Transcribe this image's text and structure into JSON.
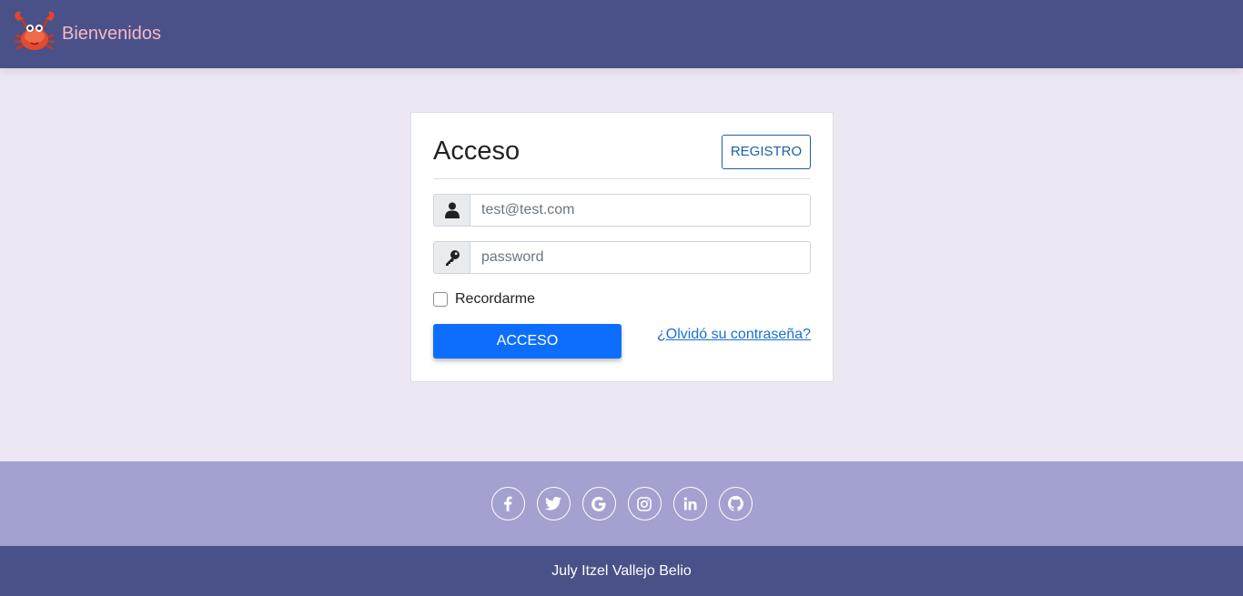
{
  "navbar": {
    "title": "Bienvenidos",
    "logo_icon": "crab-icon"
  },
  "login": {
    "title": "Acceso",
    "register_label": "REGISTRO",
    "email": {
      "placeholder": "test@test.com",
      "value": "",
      "icon": "user-icon"
    },
    "password": {
      "placeholder": "password",
      "value": "",
      "icon": "key-icon"
    },
    "remember_label": "Recordarme",
    "remember_checked": false,
    "submit_label": "ACCESO",
    "forgot_label": "¿Olvidó su contraseña?"
  },
  "social": [
    "facebook-icon",
    "twitter-icon",
    "google-icon",
    "instagram-icon",
    "linkedin-icon",
    "github-icon"
  ],
  "footer": {
    "text": "July Itzel Vallejo Belio"
  },
  "colors": {
    "navbar": "#4a5188",
    "background": "#ede6f3",
    "social_bar": "#a3a1cf",
    "primary": "#0d6efd",
    "brand_text": "#f6b8c8"
  }
}
